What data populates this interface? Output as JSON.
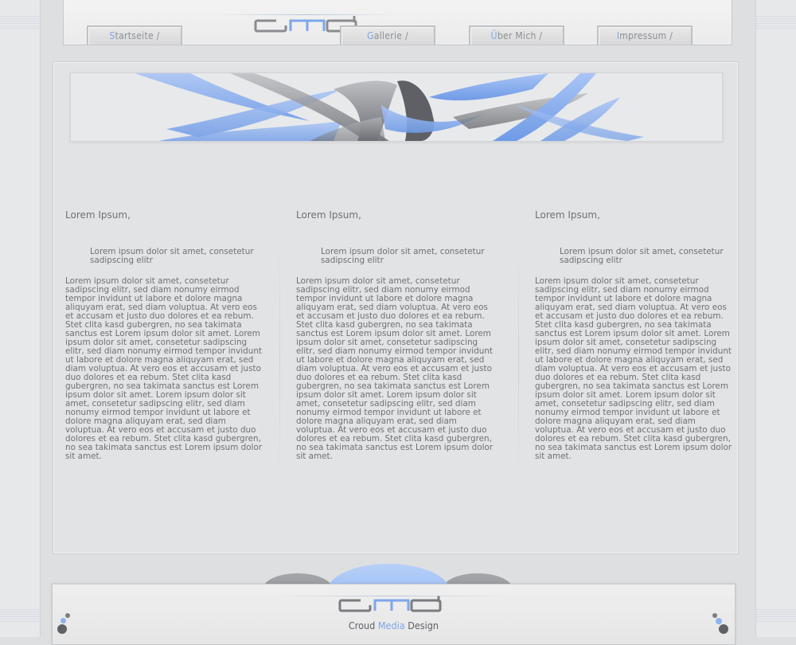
{
  "logo_text": "cmd",
  "nav": [
    {
      "first": "S",
      "rest": "tartseite /"
    },
    {
      "first": "G",
      "rest": "allerie /"
    },
    {
      "first": "Ü",
      "rest": "ber Mich /"
    },
    {
      "first": "I",
      "rest": "mpressum /"
    }
  ],
  "columns": [
    {
      "heading": "Lorem Ipsum,",
      "sub": "Lorem ipsum dolor sit amet, consetetur sadipscing elitr",
      "body": "Lorem ipsum dolor sit amet, consetetur sadipscing elitr, sed diam nonumy eirmod tempor invidunt ut labore et dolore magna aliquyam erat, sed diam voluptua. At vero eos et accusam et justo duo dolores et ea rebum. Stet clita kasd gubergren, no sea takimata sanctus est Lorem ipsum dolor sit amet. Lorem ipsum dolor sit amet, consetetur sadipscing elitr, sed diam nonumy eirmod tempor invidunt ut labore et dolore magna aliquyam erat, sed diam voluptua. At vero eos et accusam et justo duo dolores et ea rebum. Stet clita kasd gubergren, no sea takimata sanctus est Lorem ipsum dolor sit amet. Lorem ipsum dolor sit amet, consetetur sadipscing elitr, sed diam nonumy eirmod tempor invidunt ut labore et dolore magna aliquyam erat, sed diam voluptua. At vero eos et accusam et justo duo dolores et ea rebum. Stet clita kasd gubergren, no sea takimata sanctus est Lorem ipsum dolor sit amet."
    },
    {
      "heading": "Lorem Ipsum,",
      "sub": "Lorem ipsum dolor sit amet, consetetur sadipscing elitr",
      "body": "Lorem ipsum dolor sit amet, consetetur sadipscing elitr, sed diam nonumy eirmod tempor invidunt ut labore et dolore magna aliquyam erat, sed diam voluptua. At vero eos et accusam et justo duo dolores et ea rebum. Stet clita kasd gubergren, no sea takimata sanctus est Lorem ipsum dolor sit amet. Lorem ipsum dolor sit amet, consetetur sadipscing elitr, sed diam nonumy eirmod tempor invidunt ut labore et dolore magna aliquyam erat, sed diam voluptua. At vero eos et accusam et justo duo dolores et ea rebum. Stet clita kasd gubergren, no sea takimata sanctus est Lorem ipsum dolor sit amet. Lorem ipsum dolor sit amet, consetetur sadipscing elitr, sed diam nonumy eirmod tempor invidunt ut labore et dolore magna aliquyam erat, sed diam voluptua. At vero eos et accusam et justo duo dolores et ea rebum. Stet clita kasd gubergren, no sea takimata sanctus est Lorem ipsum dolor sit amet."
    },
    {
      "heading": "Lorem Ipsum,",
      "sub": "Lorem ipsum dolor sit amet, consetetur sadipscing elitr",
      "body": "Lorem ipsum dolor sit amet, consetetur sadipscing elitr, sed diam nonumy eirmod tempor invidunt ut labore et dolore magna aliquyam erat, sed diam voluptua. At vero eos et accusam et justo duo dolores et ea rebum. Stet clita kasd gubergren, no sea takimata sanctus est Lorem ipsum dolor sit amet. Lorem ipsum dolor sit amet, consetetur sadipscing elitr, sed diam nonumy eirmod tempor invidunt ut labore et dolore magna aliquyam erat, sed diam voluptua. At vero eos et accusam et justo duo dolores et ea rebum. Stet clita kasd gubergren, no sea takimata sanctus est Lorem ipsum dolor sit amet. Lorem ipsum dolor sit amet, consetetur sadipscing elitr, sed diam nonumy eirmod tempor invidunt ut labore et dolore magna aliquyam erat, sed diam voluptua. At vero eos et accusam et justo duo dolores et ea rebum. Stet clita kasd gubergren, no sea takimata sanctus est Lorem ipsum dolor sit amet."
    }
  ],
  "footer": {
    "tagline_1": "Croud ",
    "tagline_accent": "Media",
    "tagline_2": " Design"
  },
  "colors": {
    "accent_blue": "#7ea6ea",
    "text_gray": "#6e7075",
    "background": "#dedfe1"
  }
}
